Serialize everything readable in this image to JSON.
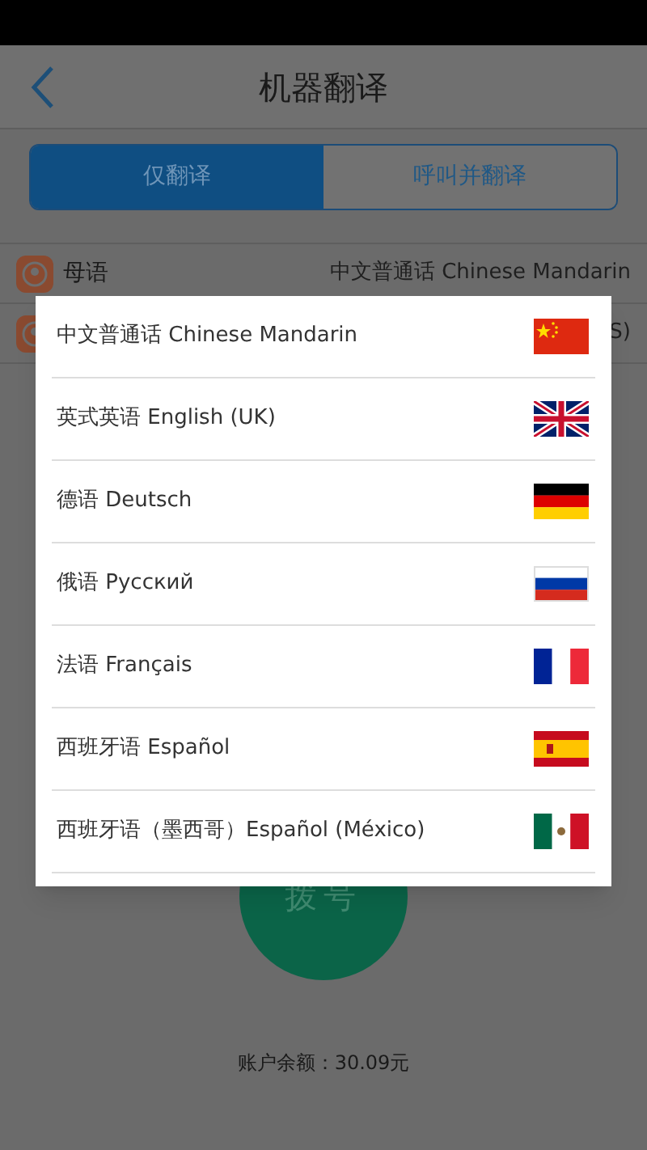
{
  "header": {
    "title": "机器翻译"
  },
  "tabs": [
    {
      "label": "仅翻译",
      "selected": true
    },
    {
      "label": "呼叫并翻译",
      "selected": false
    }
  ],
  "settings": [
    {
      "label": "母语",
      "value": "中文普通话 Chinese Mandarin"
    },
    {
      "value": "S)"
    }
  ],
  "language_picker": {
    "items": [
      {
        "label": "中文普通话 Chinese Mandarin"
      },
      {
        "label": "英式英语 English (UK)"
      },
      {
        "label": "德语 Deutsch"
      },
      {
        "label": "俄语 Русский"
      },
      {
        "label": "法语 Français"
      },
      {
        "label": "西班牙语 Español"
      },
      {
        "label": "西班牙语（墨西哥）Español (México)"
      }
    ]
  },
  "dial_button": "拨号",
  "balance": "账户余额：30.09元"
}
